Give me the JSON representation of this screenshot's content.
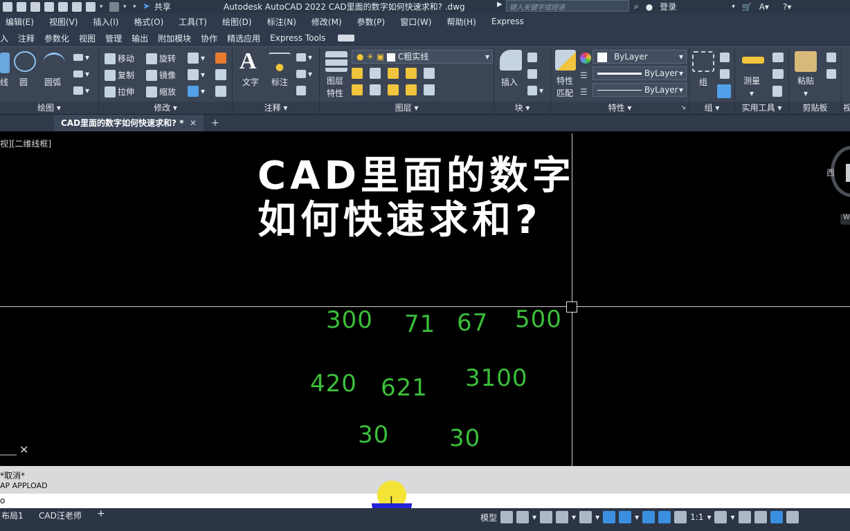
{
  "title_bar": {
    "title": "Autodesk AutoCAD 2022    CAD里面的数字如何快速求和? .dwg",
    "share": "共享",
    "search_placeholder": "键入关键字或短语",
    "login": "登录"
  },
  "menu": [
    "编辑(E)",
    "视图(V)",
    "插入(I)",
    "格式(O)",
    "工具(T)",
    "绘图(D)",
    "标注(N)",
    "修改(M)",
    "参数(P)",
    "窗口(W)",
    "帮助(H)",
    "Express"
  ],
  "ribbon_tabs": [
    "入",
    "注释",
    "参数化",
    "视图",
    "管理",
    "输出",
    "附加模块",
    "协作",
    "精选应用",
    "Express Tools"
  ],
  "ribbon": {
    "draw": {
      "title": "绘图",
      "line": "线",
      "circle": "圆",
      "arc": "圆弧"
    },
    "modify": {
      "title": "修改",
      "move": "移动",
      "rotate": "旋转",
      "copy": "复制",
      "mirror": "镜像",
      "stretch": "拉伸",
      "scale": "缩放"
    },
    "annotation": {
      "title": "注释",
      "text": "文字",
      "dim": "标注"
    },
    "layers": {
      "title": "图层",
      "props": "图层\n特性",
      "current": "C粗实线"
    },
    "block": {
      "title": "块",
      "insert": "插入"
    },
    "properties": {
      "title": "特性",
      "match": "特性\n匹配",
      "color": "ByLayer",
      "linetype": "ByLayer",
      "lineweight": "ByLayer"
    },
    "group": {
      "title": "组",
      "group": "组"
    },
    "utilities": {
      "title": "实用工具",
      "measure": "测量"
    },
    "clipboard": {
      "title": "剪贴板",
      "paste": "粘贴"
    },
    "extra": "视"
  },
  "doc_tab": {
    "name": "CAD里面的数字如何快速求和? *",
    "close": "✕",
    "add": "+"
  },
  "canvas": {
    "view_label": "视][二维线框]",
    "overlay_line1": "CAD里面的数字",
    "overlay_line2": "如何快速求和?",
    "numbers": [
      "300",
      "71",
      "67",
      "500",
      "420",
      "621",
      "3100",
      "30",
      "30"
    ],
    "viewcube_label": "西",
    "wcs": "W"
  },
  "command": {
    "history1": "*取消*",
    "history2": "AP  APPLOAD",
    "input": "o"
  },
  "status": {
    "layout1": "布局1",
    "layout2": "CAD汪老师",
    "add": "+",
    "model": "模型",
    "scale": "1:1"
  }
}
